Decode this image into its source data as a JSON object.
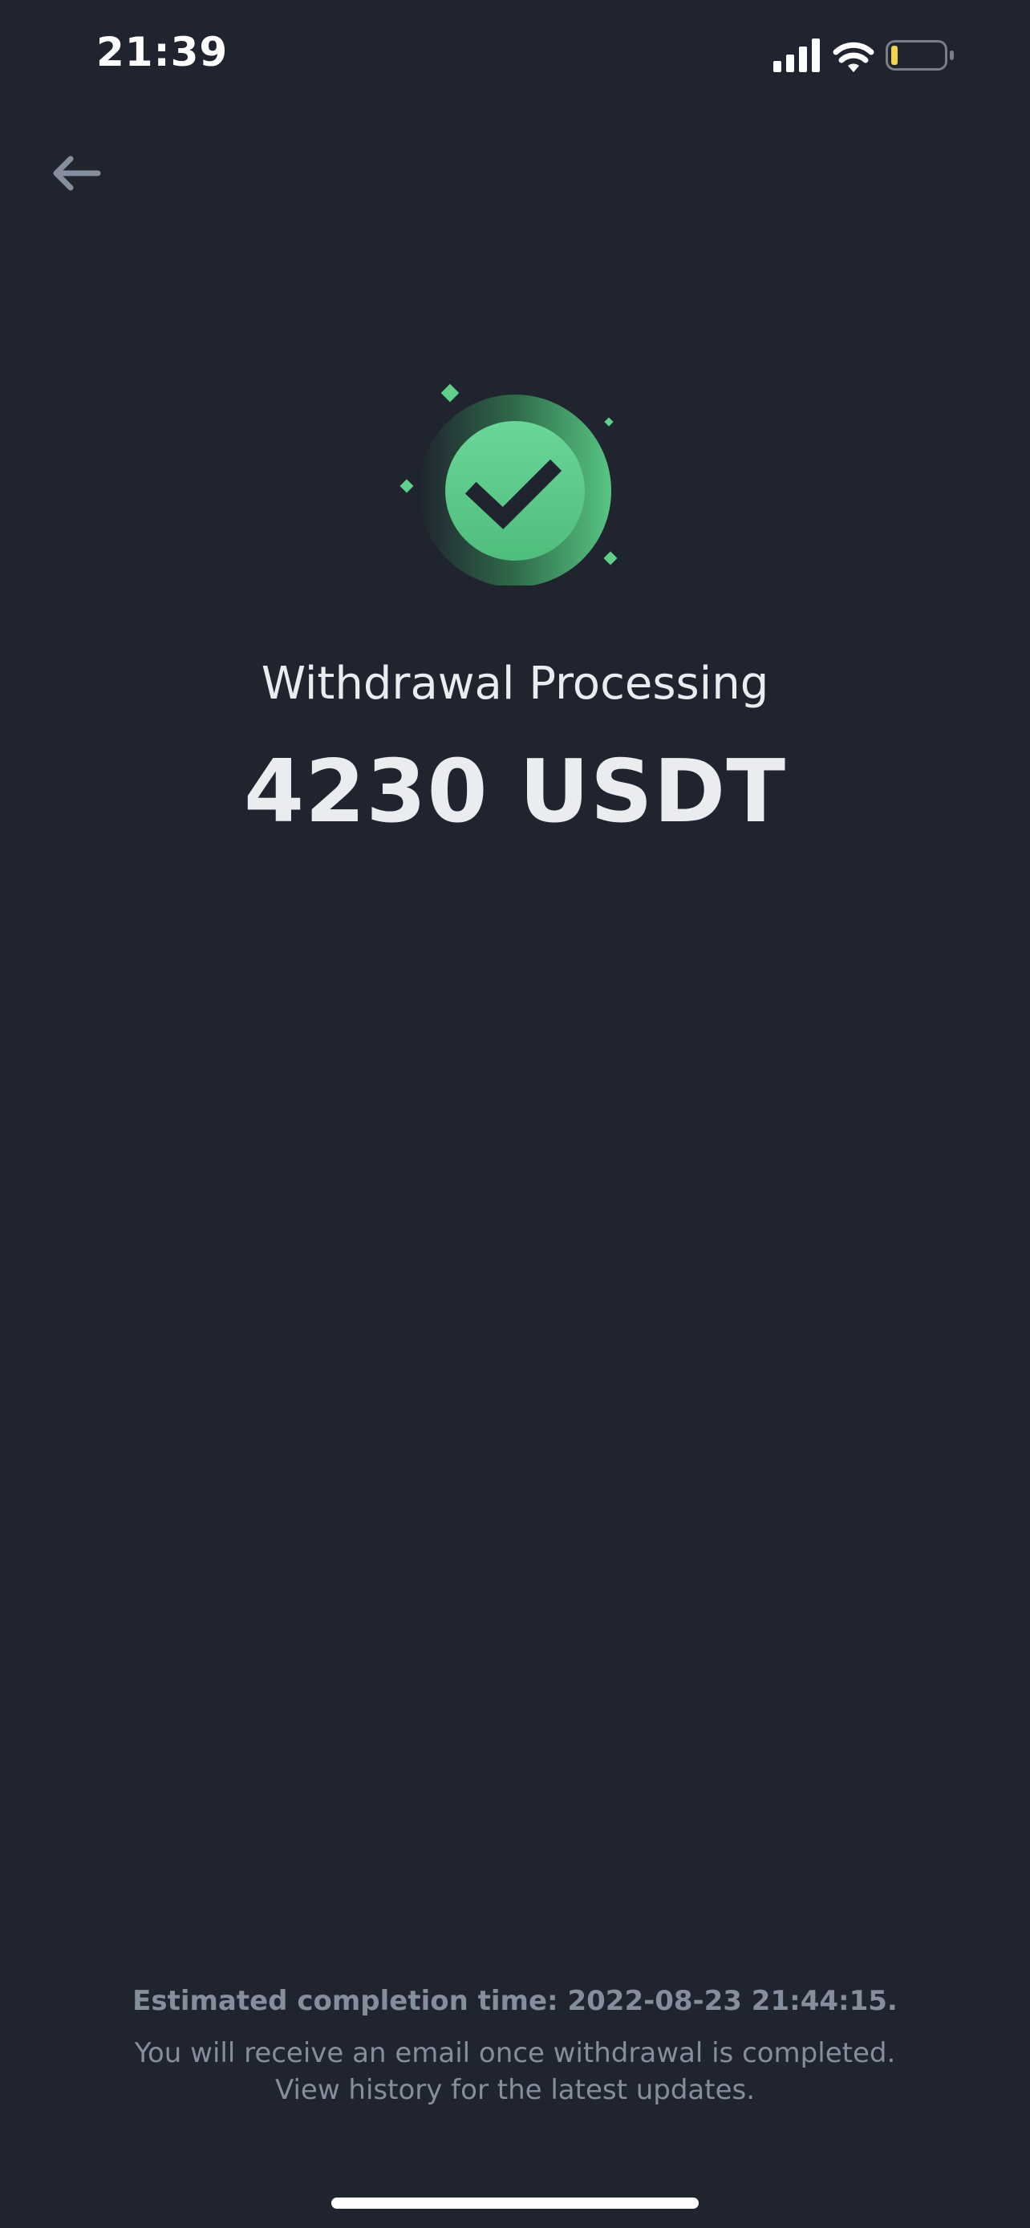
{
  "status_bar": {
    "time": "21:39",
    "signal_icon": "cellular-signal-icon",
    "wifi_icon": "wifi-icon",
    "battery_icon": "battery-icon",
    "battery_level": 0.1,
    "battery_color": "#f0d44a"
  },
  "header": {
    "back_icon": "arrow-left-icon"
  },
  "result": {
    "icon": "check-circle-icon",
    "accent_color": "#5fcf8c",
    "title": "Withdrawal Processing",
    "amount": "4230 USDT"
  },
  "footer": {
    "estimated_completion": "Estimated completion time: 2022-08-23 21:44:15.",
    "note_line_1": "You will receive an email once withdrawal is completed.",
    "note_line_2": "View history for the latest updates."
  }
}
